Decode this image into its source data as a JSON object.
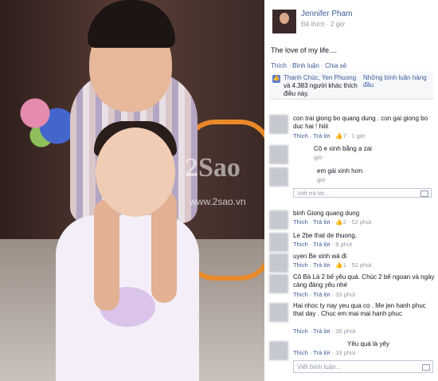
{
  "photo": {
    "watermark": "2Sao",
    "watermark_url": "www.2sao.vn"
  },
  "post": {
    "author": "Jennifer Pham",
    "meta": "Đã thích · 2 giờ",
    "text": "The love of my life....",
    "actions": {
      "like": "Thích",
      "comment": "Bình luận",
      "share": "Chia sẻ"
    },
    "likes": {
      "names": "Thanh Chúc, Yen Phuong",
      "others_text": "và 4.383 người khác thích điều này.",
      "sort": "Những bình luận hàng đầu"
    }
  },
  "comments": [
    {
      "text": "con trai giong bo quang dung . con gai giong bo duc hai ! hiiii",
      "actions": "Thích · Trả lời",
      "likes": "7",
      "time": "1 giờ"
    },
    {
      "text": "Cô e xinh bằng a zai",
      "time": "giờ"
    },
    {
      "text": "em gái xinh hơn",
      "time": "giờ"
    },
    {
      "reply_placeholder": "Viết trả lời..."
    },
    {
      "text": "binh Giong quang dung",
      "actions": "Thích · Trả lời",
      "likes": "2",
      "time": "52 phút"
    },
    {
      "text": "Le 2be that de thuong.",
      "actions": "Thích · Trả lời",
      "time": "8 phút"
    },
    {
      "text": "uyen Be xinh wá đi",
      "actions": "Thích · Trả lời",
      "likes": "1",
      "time": "52 phút"
    },
    {
      "text": "Cô Bà Lá 2 bế yêu quá. Chúc 2 bế ngoan và ngày càng đáng yêu nhé",
      "actions": "Thích · Trả lời",
      "time": "33 phút"
    },
    {
      "text": "Hai nhoc ty nay yeu qua co . Me jen hanh phuc that day . Chuc em mai mai hanh phuc",
      "actions": "Thích · Trả lời",
      "time": "35 phút"
    },
    {
      "text": "Yêu quá là yêy",
      "actions": "Thích · Trả lời",
      "time": "33 phút"
    }
  ],
  "write_comment_placeholder": "Viết bình luận..."
}
